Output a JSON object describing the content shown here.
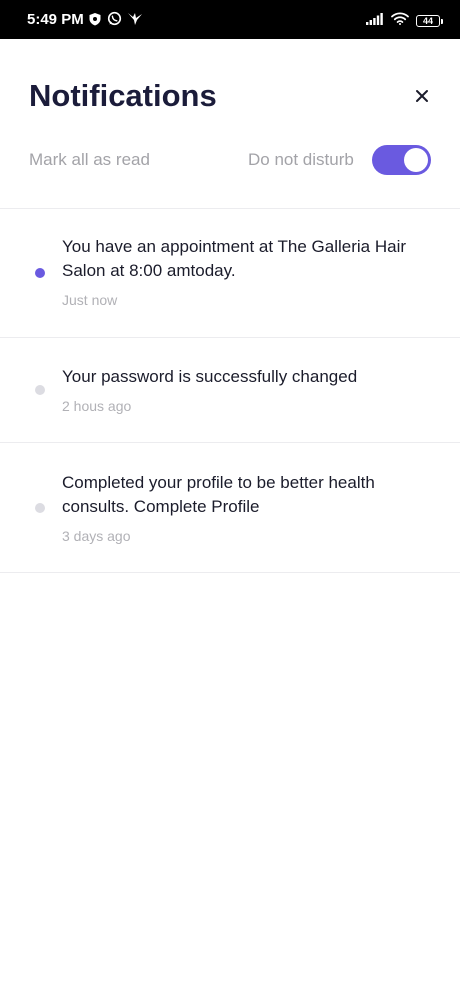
{
  "status_bar": {
    "time": "5:49 PM",
    "battery": "44",
    "icons": [
      "shield-icon",
      "whatsapp-icon",
      "bird-icon",
      "signal-icon",
      "wifi-icon",
      "battery-icon"
    ]
  },
  "header": {
    "title": "Notifications",
    "close_icon": "close-icon"
  },
  "controls": {
    "mark_all_label": "Mark all as read",
    "dnd_label": "Do not disturb",
    "dnd_enabled": true
  },
  "notifications": [
    {
      "text": "You have an appointment at The Galleria Hair Salon at 8:00 amtoday.",
      "time": "Just now",
      "unread": true
    },
    {
      "text": "Your password is successfully changed",
      "time": "2 hous ago",
      "unread": false
    },
    {
      "text": "Completed your profile to be better health consults. Complete Profile",
      "time": "3 days ago",
      "unread": false
    }
  ],
  "colors": {
    "accent": "#6a5ae0",
    "title": "#1b1c3a",
    "muted": "#a3a3a8",
    "dot_read": "#dcdce2"
  }
}
